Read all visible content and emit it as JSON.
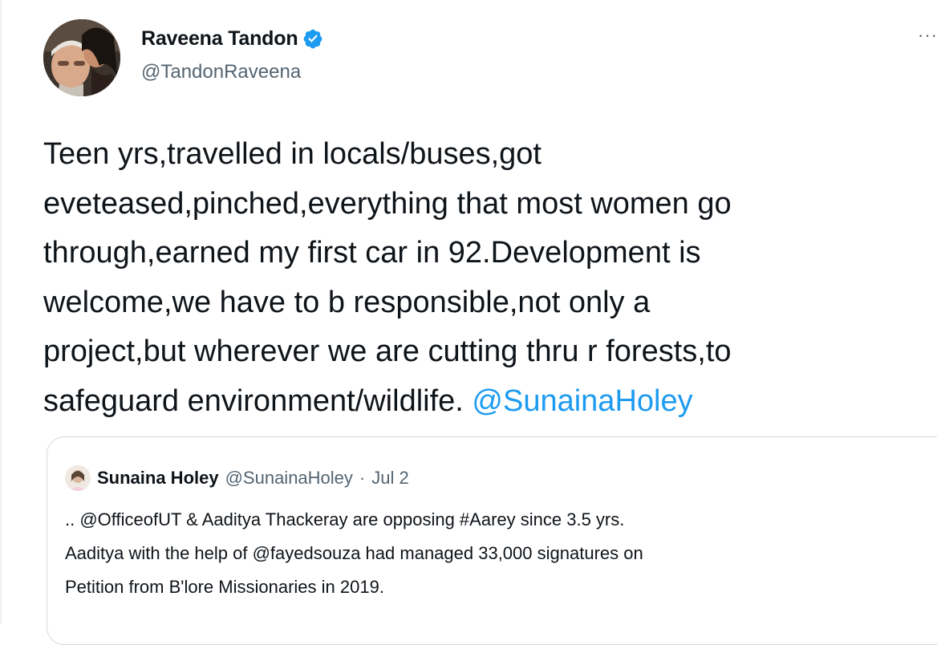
{
  "tweet": {
    "author": {
      "name": "Raveena Tandon",
      "handle": "@TandonRaveena",
      "verified": true
    },
    "more_label": "···",
    "text": "Teen yrs,travelled in locals/buses,got\neveteased,pinched,everything that most women go\nthrough,earned my first car in 92.Development is\nwelcome,we have to b responsible,not only a\nproject,but wherever we are cutting thru r forests,to\nsafeguard environment/wildlife. ",
    "mention": "@SunainaHoley"
  },
  "quote": {
    "author_name": "Sunaina Holey",
    "author_handle": "@SunainaHoley",
    "separator": "·",
    "date": "Jul 2",
    "text": ".. @OfficeofUT & Aaditya Thackeray are opposing #Aarey since 3.5 yrs.\nAaditya with the help of @fayedsouza had managed 33,000 signatures on\nPetition from B'lore Missionaries in 2019."
  },
  "colors": {
    "link": "#1d9bf0",
    "verified_badge": "#1d9bf0",
    "secondary_text": "#536471",
    "border": "#cfd9de"
  },
  "icons": {
    "verified": "verified-badge-icon",
    "more": "more-horizontal-icon"
  }
}
